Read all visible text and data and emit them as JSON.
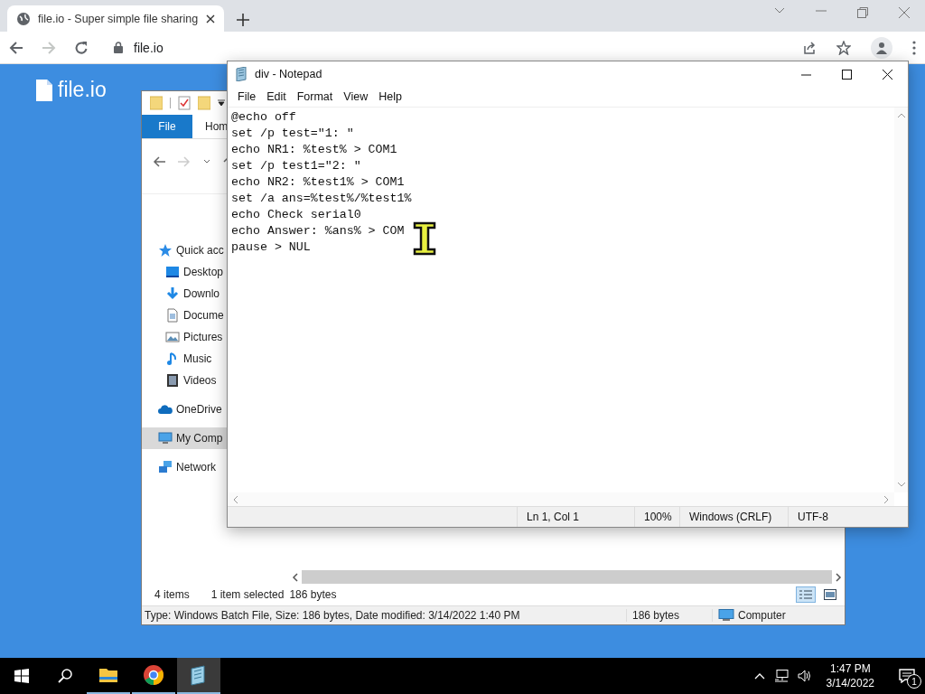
{
  "browser": {
    "tab": {
      "title": "file.io - Super simple file sharing"
    },
    "address": "file.io",
    "forward_disabled": true
  },
  "page": {
    "logo": "file.io"
  },
  "explorer": {
    "ribbon_tabs": [
      {
        "label": "File",
        "kind": "menu"
      },
      {
        "label": "Hom",
        "kind": "tab"
      }
    ],
    "nav_items": [
      {
        "label": "Quick acc",
        "selected": false
      },
      {
        "label": "Desktop",
        "selected": false
      },
      {
        "label": "Downlo",
        "selected": false
      },
      {
        "label": "Docume",
        "selected": false
      },
      {
        "label": "Pictures",
        "selected": false
      },
      {
        "label": "Music",
        "selected": false
      },
      {
        "label": "Videos",
        "selected": false
      },
      {
        "label": "OneDrive",
        "selected": false
      },
      {
        "label": "My Comp",
        "selected": true
      },
      {
        "label": "Network",
        "selected": false
      }
    ],
    "item_count": "4 items",
    "selection": "1 item selected",
    "selection_size": "186 bytes",
    "details": "Type: Windows Batch File, Size: 186 bytes, Date modified: 3/14/2022 1:40 PM",
    "details_size": "186 bytes",
    "location": "Computer"
  },
  "notepad": {
    "title": "div - Notepad",
    "menu": [
      "File",
      "Edit",
      "Format",
      "View",
      "Help"
    ],
    "lines": [
      "@echo off",
      "set /p test=\"1: \"",
      "echo NR1: %test% > COM1",
      "set /p test1=\"2: \"",
      "echo NR2: %test1% > COM1",
      "set /a ans=%test%/%test1%",
      "echo Check serial0",
      "echo Answer: %ans% > COM",
      "pause > NUL"
    ],
    "status": {
      "position": "Ln 1, Col 1",
      "zoom": "100%",
      "line_ending": "Windows (CRLF)",
      "encoding": "UTF-8"
    }
  },
  "taskbar": {
    "apps": [
      {
        "kind": "explorer",
        "active": false
      },
      {
        "kind": "chrome",
        "active": false
      },
      {
        "kind": "notepad",
        "active": true
      }
    ],
    "time": "1:47 PM",
    "date": "3/14/2022",
    "notifications": "1"
  }
}
